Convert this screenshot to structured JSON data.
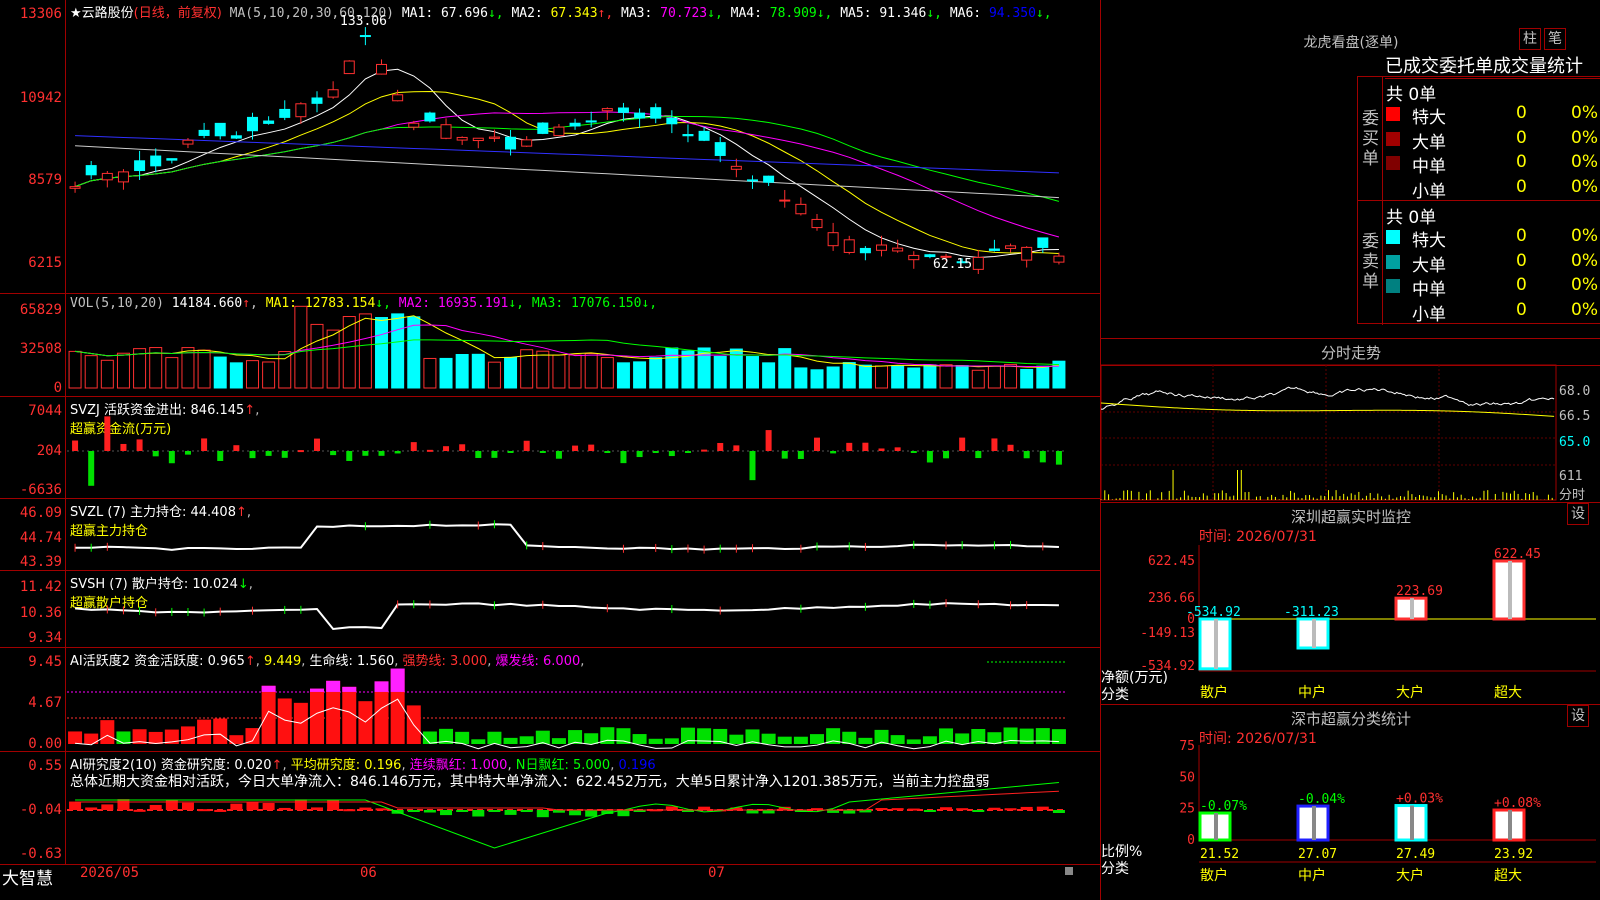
{
  "main": {
    "stock": "★云路股份",
    "mode": "(日线，前复权)",
    "ma_label": "MA(5,10,20,30,60,120)",
    "mas": [
      {
        "k": "MA1",
        "v": "67.696",
        "a": "↓",
        "c": "#ffffff"
      },
      {
        "k": "MA2",
        "v": "67.343",
        "a": "↑",
        "c": "#ffff00"
      },
      {
        "k": "MA3",
        "v": "70.723",
        "a": "↓",
        "c": "#ff00ff"
      },
      {
        "k": "MA4",
        "v": "78.909",
        "a": "↓",
        "c": "#00ff00"
      },
      {
        "k": "MA5",
        "v": "91.346",
        "a": "↓",
        "c": "#ffffff"
      },
      {
        "k": "MA6",
        "v": "94.350",
        "a": "↓",
        "c": "#0000ff"
      }
    ],
    "y": [
      "13306",
      "10942",
      "8579",
      "6215"
    ],
    "high_mark": "133.06",
    "low_mark": "62.15"
  },
  "vol": {
    "label": "VOL(5,10,20)",
    "value": "14184.660",
    "a": "↑",
    "mas": [
      {
        "k": "MA1",
        "v": "12783.154",
        "a": "↓",
        "c": "#ffff00"
      },
      {
        "k": "MA2",
        "v": "16935.191",
        "a": "↓",
        "c": "#ff00ff"
      },
      {
        "k": "MA3",
        "v": "17076.150",
        "a": "↓",
        "c": "#00ff00"
      }
    ],
    "y": [
      "65829",
      "32508",
      "0"
    ]
  },
  "svzj": {
    "label": "SVZJ  活跃资金进出: 846.145",
    "a": "↑",
    "sub": "超赢资金流(万元)",
    "y": [
      "7044",
      "204",
      "-6636"
    ]
  },
  "svzl": {
    "label": "SVZL (7) 主力持仓: 44.408",
    "a": "↑",
    "sub": "超赢主力持仓",
    "y": [
      "46.09",
      "44.74",
      "43.39"
    ]
  },
  "svsh": {
    "label": "SVSH (7) 散户持仓: 10.024",
    "a": "↓",
    "sub": "超赢散户持仓",
    "y": [
      "11.42",
      "10.36",
      "9.34"
    ]
  },
  "ai1": {
    "label": "AI活跃度2 资金活跃度: 0.965",
    "a": "↑",
    "v2": "9.449",
    "life": "生命线: 1.560",
    "strong": "强势线: 3.000",
    "burst": "爆发线: 6.000",
    "y": [
      "9.45",
      "4.67",
      "0.00"
    ]
  },
  "ai2": {
    "label": "AI研究度2(10) 资金研究度: 0.020",
    "a": "↑",
    "avg": "平均研究度: 0.196",
    "lx": "连续飘红: 1.000",
    "nd": "N日飘红: 5.000",
    "last": "0.196",
    "desc": "总体近期大资金相对活跃，今日大单净流入：846.146万元，其中特大单净流入：622.452万元，大单5日累计净入1201.385万元，当前主力控盘弱",
    "y": [
      "0.55",
      "-0.04",
      "-0.63"
    ]
  },
  "xaxis": {
    "d1": "2026/05",
    "d2": "06",
    "d3": "07"
  },
  "brand": "大智慧",
  "lhb": {
    "title": "龙虎看盘(逐单)",
    "btn1": "柱",
    "btn2": "笔",
    "tabs": "已成交委托单成交量统计",
    "buy": {
      "total": "共 0单",
      "side": "委买单",
      "rows": [
        {
          "n": "特大",
          "c": "#ff0000",
          "v": "0",
          "p": "0%"
        },
        {
          "n": "大单",
          "c": "#a00000",
          "v": "0",
          "p": "0%"
        },
        {
          "n": "中单",
          "c": "#800000",
          "v": "0",
          "p": "0%"
        },
        {
          "n": "小单",
          "c": "",
          "v": "0",
          "p": "0%"
        }
      ]
    },
    "sell": {
      "total": "共 0单",
      "side": "委卖单",
      "rows": [
        {
          "n": "特大",
          "c": "#00ffff",
          "v": "0",
          "p": "0%"
        },
        {
          "n": "大单",
          "c": "#00a0a0",
          "v": "0",
          "p": "0%"
        },
        {
          "n": "中单",
          "c": "#008080",
          "v": "0",
          "p": "0%"
        },
        {
          "n": "小单",
          "c": "",
          "v": "0",
          "p": "0%"
        }
      ]
    }
  },
  "fs": {
    "title": "分时走势",
    "y": [
      "68.0",
      "66.5",
      "65.0",
      "611"
    ],
    "unit": "分时"
  },
  "sz": {
    "title": "深圳超赢实时监控",
    "btn": "设",
    "time": "时间: 2026/07/31",
    "y": [
      "622.45",
      "236.66",
      "0",
      "-149.13",
      "-534.92"
    ],
    "net": "净额(万元)",
    "cls": "分类",
    "bars": [
      {
        "n": "散户",
        "v": "-534.92"
      },
      {
        "n": "中户",
        "v": "-311.23"
      },
      {
        "n": "大户",
        "v": "223.69"
      },
      {
        "n": "超大",
        "v": "622.45"
      }
    ]
  },
  "fl": {
    "title": "深市超赢分类统计",
    "btn": "设",
    "time": "时间: 2026/07/31",
    "y": [
      "75",
      "50",
      "25",
      "0"
    ],
    "ratio": "比例%",
    "cls": "分类",
    "bars": [
      {
        "n": "散户",
        "v": "21.52",
        "d": "-0.07%"
      },
      {
        "n": "中户",
        "v": "27.07",
        "d": "-0.04%"
      },
      {
        "n": "大户",
        "v": "27.49",
        "d": "+0.03%"
      },
      {
        "n": "超大",
        "v": "23.92",
        "d": "+0.08%"
      }
    ]
  }
}
